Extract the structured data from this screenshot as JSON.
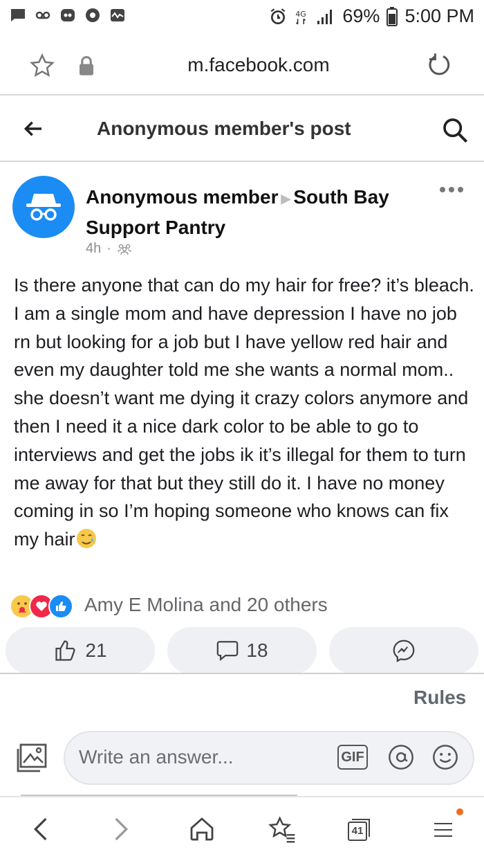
{
  "status_bar": {
    "battery": "69%",
    "time": "5:00 PM",
    "icons": [
      "message-icon",
      "voicemail-icon",
      "app-icon",
      "chrome-icon",
      "activity-icon",
      "alarm-icon",
      "data-icon",
      "signal-icon",
      "battery-icon"
    ]
  },
  "url_bar": {
    "url": "m.facebook.com",
    "icons": [
      "star-icon",
      "lock-icon",
      "reload-icon"
    ]
  },
  "header": {
    "title": "Anonymous member's post"
  },
  "post": {
    "author": "Anonymous member",
    "group": "South Bay Support Pantry",
    "time": "4h",
    "separator": "·",
    "body": "Is there anyone that can do my hair for free? it’s bleach. I am a single mom and have depression I have no job rn but looking for a job but I have yellow red hair and even my daughter told me she wants a normal mom.. she doesn’t want me dying it crazy colors anymore and then I need it a nice dark color to be able to go to interviews and get the jobs ik it’s illegal for them to turn me away for that but they still do it. I have no money coming in so I’m hoping someone who knows can fix my hair"
  },
  "reactions": {
    "text": "Amy E Molina and 20 others",
    "types": [
      "care",
      "love",
      "like"
    ]
  },
  "actions": {
    "likes": "21",
    "comments": "18"
  },
  "rules_label": "Rules",
  "composer": {
    "placeholder": "Write an answer...",
    "gif_label": "GIF"
  },
  "bottom_nav": {
    "tabs_count": "41"
  },
  "colors": {
    "facebook_blue": "#1a8cf3",
    "love_red": "#f0284a",
    "notification_orange": "#f36b21"
  }
}
